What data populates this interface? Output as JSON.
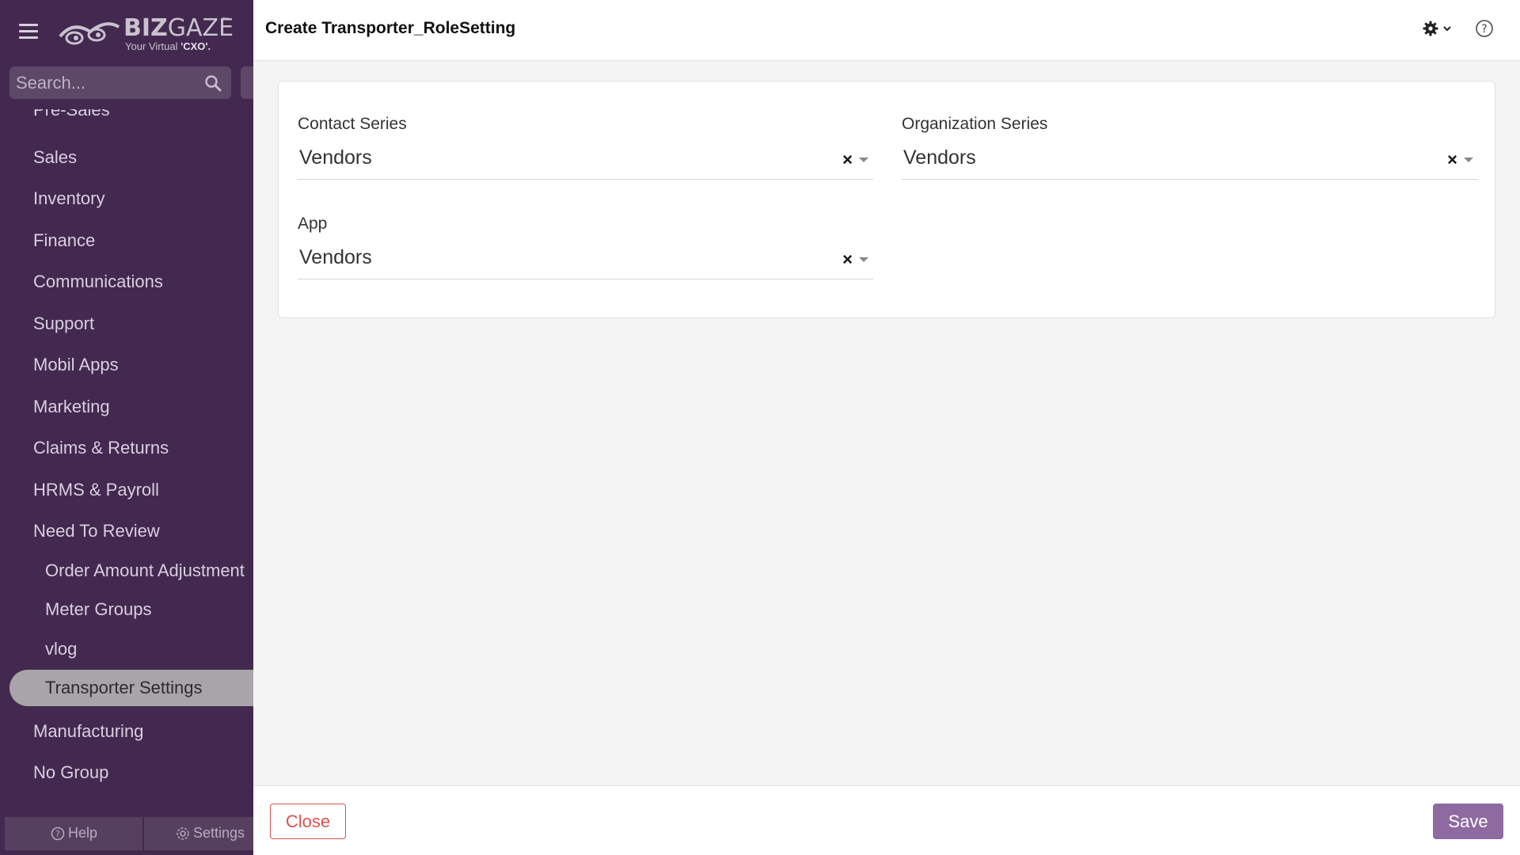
{
  "app": {
    "logo_brand_bold": "BIZ",
    "logo_brand_light": "GAZE",
    "logo_tm": "™",
    "logo_tagline_prefix": "Your Virtual ",
    "logo_tagline_bold": "'CXO'."
  },
  "sidebar": {
    "search_placeholder": "Search...",
    "partial_item": "Pre-Sales",
    "items": [
      {
        "label": "Sales"
      },
      {
        "label": "Inventory"
      },
      {
        "label": "Finance"
      },
      {
        "label": "Communications"
      },
      {
        "label": "Support"
      },
      {
        "label": "Mobil Apps"
      },
      {
        "label": "Marketing"
      },
      {
        "label": "Claims & Returns"
      },
      {
        "label": "HRMS & Payroll"
      },
      {
        "label": "Need To Review"
      }
    ],
    "sub_items": [
      {
        "label": "Order Amount Adjustment"
      },
      {
        "label": "Meter Groups"
      },
      {
        "label": "vlog"
      },
      {
        "label": "Transporter Settings",
        "active": true
      }
    ],
    "bottom_items": [
      {
        "label": "Manufacturing"
      },
      {
        "label": "No Group"
      }
    ],
    "footer": {
      "help_label": "Help",
      "settings_label": "Settings"
    }
  },
  "header": {
    "title": "Create Transporter_RoleSetting",
    "icons": [
      "gear-icon",
      "chevron-down-icon",
      "help-circle-icon"
    ]
  },
  "form": {
    "contact_series": {
      "label": "Contact Series",
      "value": "Vendors"
    },
    "organization_series": {
      "label": "Organization Series",
      "value": "Vendors"
    },
    "app": {
      "label": "App",
      "value": "Vendors"
    }
  },
  "footer": {
    "close_label": "Close",
    "save_label": "Save"
  },
  "colors": {
    "sidebar_bg": "#43294f",
    "accent": "#8e6aa1",
    "danger": "#d9534f"
  }
}
